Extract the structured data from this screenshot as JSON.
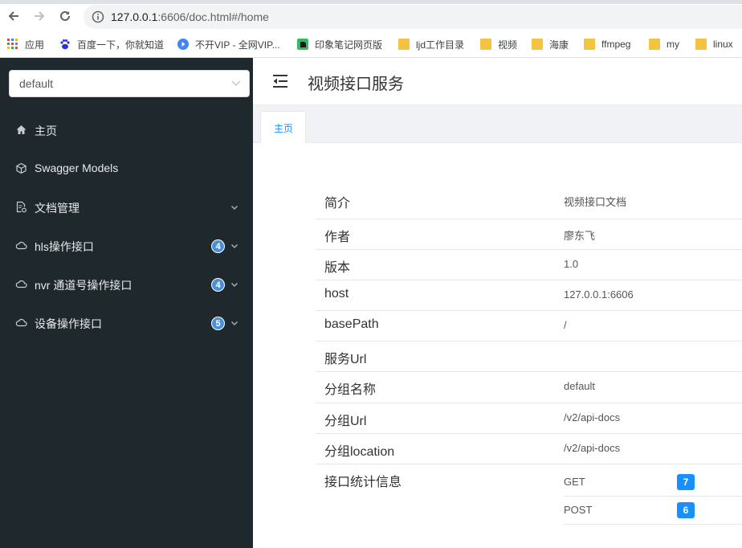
{
  "browser": {
    "url_host": "127.0.0.1",
    "url_rest": ":6606/doc.html#/home",
    "bookmarks": [
      {
        "label": "应用",
        "icon": "apps-grid-icon"
      },
      {
        "label": "百度一下，你就知道",
        "icon": "baidu-paw-icon"
      },
      {
        "label": "不开VIP - 全网VIP...",
        "icon": "play-circle-icon"
      },
      {
        "label": "印象笔记网页版",
        "icon": "evernote-icon"
      },
      {
        "label": "ljd工作目录",
        "icon": "folder-icon"
      },
      {
        "label": "视频",
        "icon": "folder-icon"
      },
      {
        "label": "海康",
        "icon": "folder-icon"
      },
      {
        "label": "ffmpeg",
        "icon": "folder-icon"
      },
      {
        "label": "my",
        "icon": "folder-icon"
      },
      {
        "label": "linux",
        "icon": "folder-icon"
      }
    ]
  },
  "sidebar": {
    "group_select": "default",
    "items": [
      {
        "label": "主页",
        "icon": "home-icon"
      },
      {
        "label": "Swagger Models",
        "icon": "cube-icon"
      },
      {
        "label": "文档管理",
        "icon": "document-gear-icon"
      },
      {
        "label": "hls操作接口",
        "icon": "cloud-icon",
        "badge": "4"
      },
      {
        "label": "nvr 通道号操作接口",
        "icon": "cloud-icon",
        "badge": "4"
      },
      {
        "label": "设备操作接口",
        "icon": "cloud-icon",
        "badge": "5"
      }
    ]
  },
  "header": {
    "title": "视频接口服务"
  },
  "tabs": [
    {
      "label": "主页"
    }
  ],
  "info": {
    "rows": [
      {
        "key": "简介",
        "value": "视频接口文档"
      },
      {
        "key": "作者",
        "value": "廖东飞"
      },
      {
        "key": "版本",
        "value": "1.0"
      },
      {
        "key": "host",
        "value": "127.0.0.1:6606"
      },
      {
        "key": "basePath",
        "value": "/"
      },
      {
        "key": "服务Url",
        "value": ""
      },
      {
        "key": "分组名称",
        "value": "default"
      },
      {
        "key": "分组Url",
        "value": "/v2/api-docs"
      },
      {
        "key": "分组location",
        "value": "/v2/api-docs"
      }
    ],
    "stats_label": "接口统计信息",
    "stats": [
      {
        "method": "GET",
        "count": "7"
      },
      {
        "method": "POST",
        "count": "6"
      }
    ]
  },
  "colors": {
    "sidebar_bg": "#1f282d",
    "accent": "#1890ff",
    "badge": "#4a90d9"
  }
}
